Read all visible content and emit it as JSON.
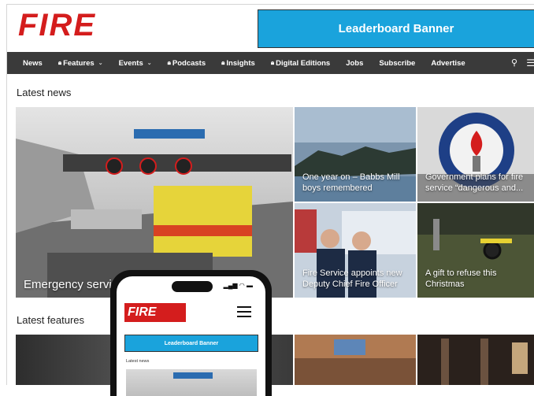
{
  "header": {
    "logo_text": "FIRE",
    "leaderboard": "Leaderboard Banner"
  },
  "nav": {
    "items": [
      {
        "label": "News",
        "locked": false,
        "dropdown": false
      },
      {
        "label": "Features",
        "locked": true,
        "dropdown": true
      },
      {
        "label": "Events",
        "locked": false,
        "dropdown": true
      },
      {
        "label": "Podcasts",
        "locked": true,
        "dropdown": false
      },
      {
        "label": "Insights",
        "locked": true,
        "dropdown": false
      },
      {
        "label": "Digital Editions",
        "locked": true,
        "dropdown": false
      },
      {
        "label": "Jobs",
        "locked": false,
        "dropdown": false
      },
      {
        "label": "Subscribe",
        "locked": false,
        "dropdown": false
      },
      {
        "label": "Advertise",
        "locked": false,
        "dropdown": false
      }
    ],
    "search_icon": "search-icon",
    "menu_icon": "hamburger-icon"
  },
  "latest_news": {
    "title": "Latest news",
    "tiles": [
      {
        "caption": "Emergency servic"
      },
      {
        "caption": "One year on – Babbs Mill boys remembered"
      },
      {
        "caption": "Government plans for fire service “dangerous and..."
      },
      {
        "caption": "Fire Service appoints new Deputy Chief Fire Officer"
      },
      {
        "caption": "A gift to refuse this Christmas"
      }
    ]
  },
  "latest_features": {
    "title": "Latest features"
  },
  "phone": {
    "logo": "FIRE",
    "leaderboard": "Leaderboard Banner",
    "latest_news": "Latest news"
  },
  "colors": {
    "brand_red": "#d41d1d",
    "banner_blue": "#1aa3dc",
    "nav_bg": "#3a3a3a"
  }
}
